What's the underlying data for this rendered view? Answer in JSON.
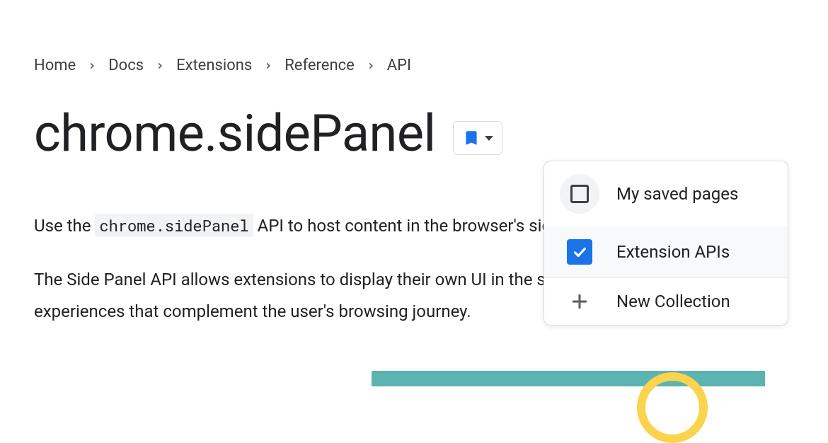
{
  "breadcrumb": {
    "items": [
      {
        "label": "Home"
      },
      {
        "label": "Docs"
      },
      {
        "label": "Extensions"
      },
      {
        "label": "Reference"
      },
      {
        "label": "API"
      }
    ]
  },
  "page": {
    "title": "chrome.sidePanel"
  },
  "body": {
    "p1_before": "Use the ",
    "p1_code": "chrome.sidePanel",
    "p1_after": " API to host content in the browser's side panel alongside the",
    "p2": "The Side Panel API allows extensions to display their own UI in the side panel, enabling persistent experiences that complement the user's browsing journey."
  },
  "dropdown": {
    "items": [
      {
        "label": "My saved pages",
        "checked": false
      },
      {
        "label": "Extension APIs",
        "checked": true
      }
    ],
    "new_collection_label": "New Collection"
  }
}
